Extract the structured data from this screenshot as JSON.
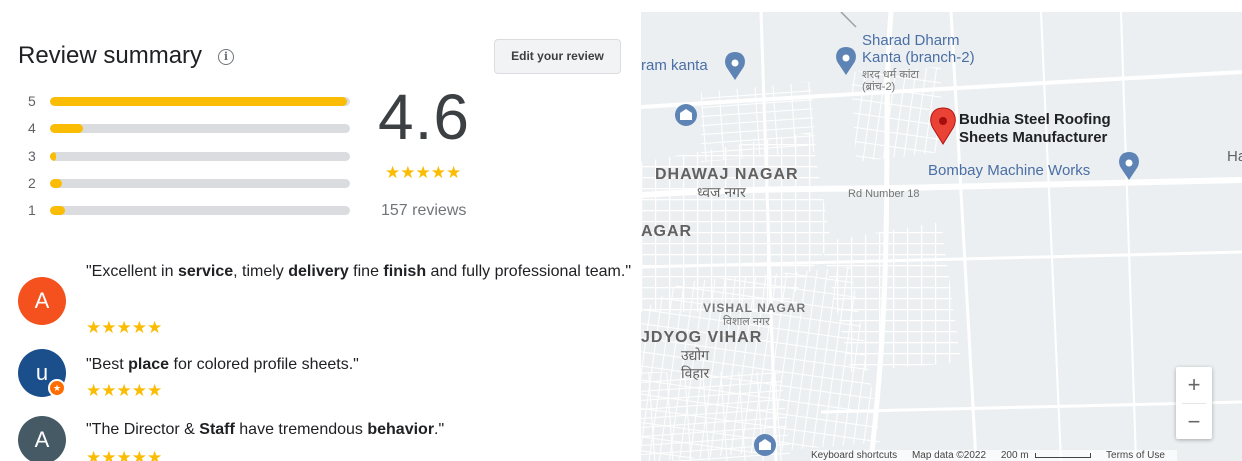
{
  "review_summary": {
    "title": "Review summary",
    "info_icon": "info-icon",
    "edit_button": "Edit your review",
    "histogram": [
      {
        "label": "5",
        "fraction": 0.99
      },
      {
        "label": "4",
        "fraction": 0.11
      },
      {
        "label": "3",
        "fraction": 0.02
      },
      {
        "label": "2",
        "fraction": 0.04
      },
      {
        "label": "1",
        "fraction": 0.05
      }
    ],
    "rating": "4.6",
    "rating_stars": "★★★★★",
    "review_count": "157 reviews",
    "reviews": [
      {
        "avatar_letter": "A",
        "avatar_color": "#f4511e",
        "text_parts": [
          {
            "t": "\"Excellent in ",
            "b": false
          },
          {
            "t": "service",
            "b": true
          },
          {
            "t": ", timely ",
            "b": false
          },
          {
            "t": "delivery",
            "b": true
          },
          {
            "t": " fine ",
            "b": false
          },
          {
            "t": "finish",
            "b": true
          },
          {
            "t": " and fully professional team.\"",
            "b": false
          }
        ],
        "stars": "★★★★★"
      },
      {
        "avatar_letter": "u",
        "avatar_color": "#1a4f8b",
        "badge": "★",
        "text_parts": [
          {
            "t": "\"Best ",
            "b": false
          },
          {
            "t": "place",
            "b": true
          },
          {
            "t": " for colored profile sheets.\"",
            "b": false
          }
        ],
        "stars": "★★★★★"
      },
      {
        "avatar_letter": "A",
        "avatar_color": "#455a64",
        "text_parts": [
          {
            "t": "\"The Director & ",
            "b": false
          },
          {
            "t": "Staff",
            "b": true
          },
          {
            "t": " have tremendous ",
            "b": false
          },
          {
            "t": "behavior",
            "b": true
          },
          {
            "t": ".\"",
            "b": false
          }
        ],
        "stars": "★★★★★"
      }
    ]
  },
  "map": {
    "labels": {
      "ram_kanta": "ram kanta",
      "sharad_1": "Sharad Dharm",
      "sharad_2": "Kanta (branch-2)",
      "sharad_hindi_1": "शरद धर्म कांटा",
      "sharad_hindi_2": "(ब्रांच-2)",
      "budhia_1": "Budhia Steel Roofing",
      "budhia_2": "Sheets Manufacturer",
      "bombay": "Bombay Machine Works",
      "ha": "Ha",
      "dhawaj": "DHAWAJ NAGAR",
      "dhawaj_hindi": "ध्वज नगर",
      "road18": "Rd Number 18",
      "agar": "AGAR",
      "vishal": "VISHAL NAGAR",
      "vishal_hindi": "विशाल नगर",
      "udyog": "JDYOG VIHAR",
      "udyog_hindi_1": "उद्योग",
      "udyog_hindi_2": "विहार"
    },
    "zoom_in": "+",
    "zoom_out": "−",
    "footer": {
      "shortcuts": "Keyboard shortcuts",
      "map_data": "Map data ©2022",
      "scale": "200 m",
      "terms": "Terms of Use"
    },
    "colors": {
      "background": "#eceff1",
      "road": "#ffffff",
      "pin_red": "#ea4335",
      "poi_blue": "#5e84b5"
    }
  }
}
